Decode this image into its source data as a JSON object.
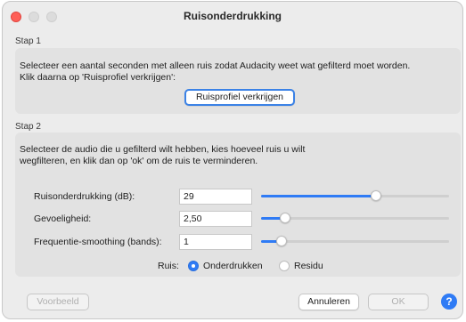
{
  "window": {
    "title": "Ruisonderdrukking"
  },
  "step1": {
    "label": "Stap 1",
    "instructions": "Selecteer een aantal seconden met alleen ruis zodat Audacity weet wat gefilterd moet worden.\nKlik daarna op 'Ruisprofiel verkrijgen':",
    "button_label": "Ruisprofiel verkrijgen"
  },
  "step2": {
    "label": "Stap 2",
    "instructions": "Selecteer de audio die u gefilterd wilt hebben, kies hoeveel ruis u wilt\nwegfilteren, en klik dan op 'ok' om de ruis te verminderen.",
    "fields": [
      {
        "label": "Ruisonderdrukking (dB):",
        "value": "29",
        "slider_fraction": 0.61
      },
      {
        "label": "Gevoeligheid:",
        "value": "2,50",
        "slider_fraction": 0.13
      },
      {
        "label": "Frequentie-smoothing (bands):",
        "value": "1",
        "slider_fraction": 0.11
      }
    ],
    "noise": {
      "label": "Ruis:",
      "options": [
        {
          "label": "Onderdrukken",
          "selected": true
        },
        {
          "label": "Residu",
          "selected": false
        }
      ]
    }
  },
  "footer": {
    "preview_label": "Voorbeeld",
    "cancel_label": "Annuleren",
    "ok_label": "OK",
    "help_label": "?"
  },
  "colors": {
    "accent": "#2f7bf5",
    "close": "#fe5f57"
  }
}
